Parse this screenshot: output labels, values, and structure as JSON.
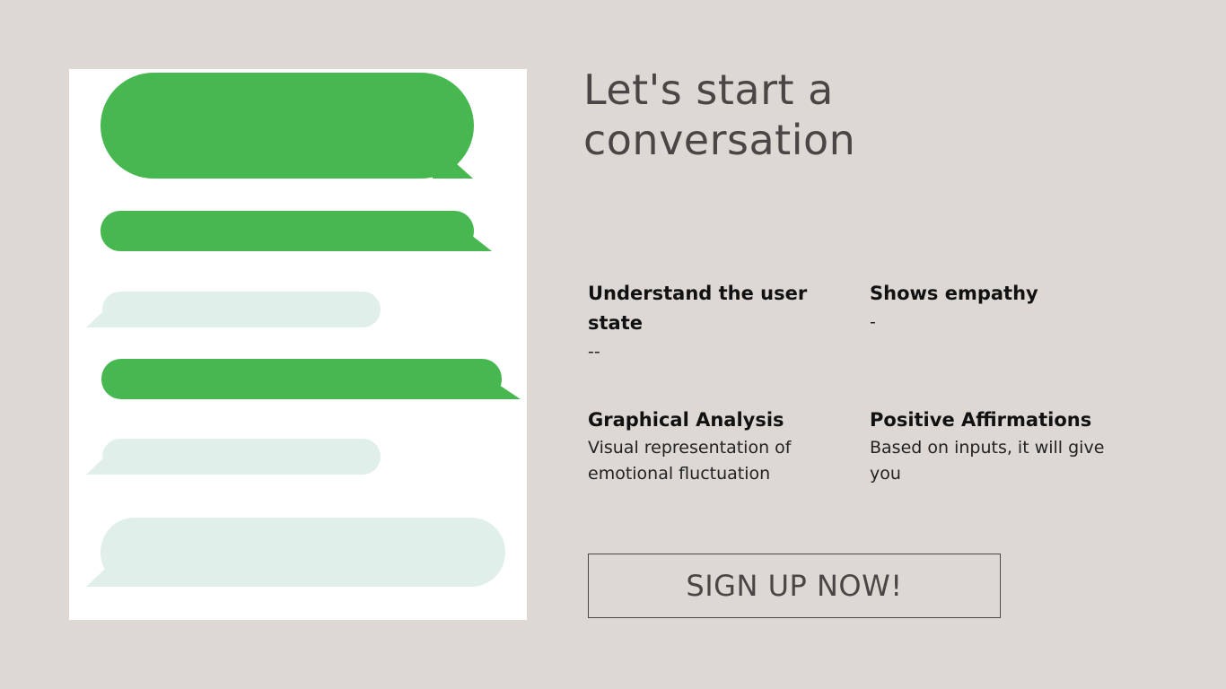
{
  "headline": "Let's start a conversation",
  "features": [
    {
      "title": "Understand the user state",
      "description": "--"
    },
    {
      "title": "Shows empathy",
      "description": "-"
    },
    {
      "title": "Graphical Analysis",
      "description": "Visual representation of emotional fluctuation"
    },
    {
      "title": "Positive Affirmations",
      "description": "Based on inputs, it will give you"
    }
  ],
  "cta": {
    "label": "SIGN UP NOW!"
  },
  "colors": {
    "background": "#ddd8d4",
    "sent_bubble": "#47b74f",
    "received_bubble": "#e0efea",
    "heading_text": "#4a4646"
  }
}
